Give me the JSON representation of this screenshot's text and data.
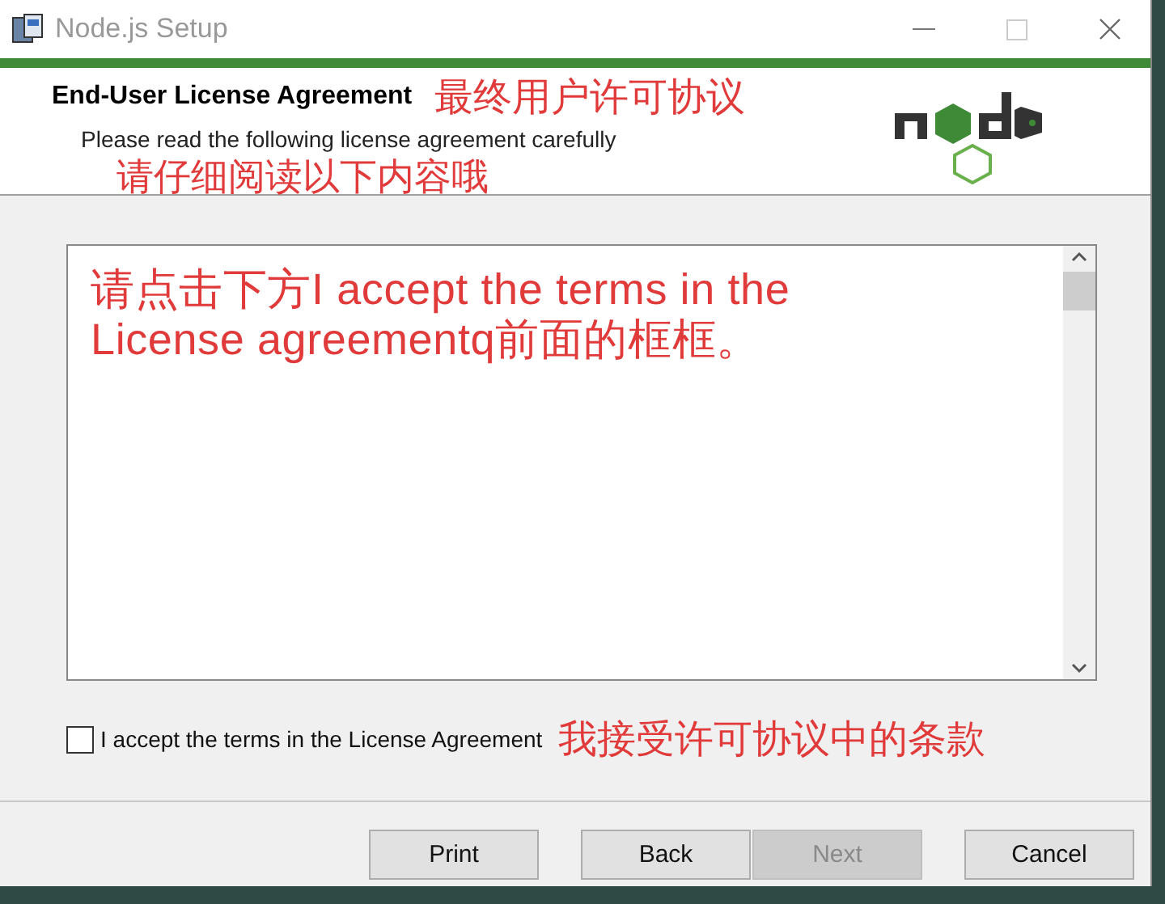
{
  "window": {
    "title": "Node.js Setup"
  },
  "header": {
    "title": "End-User License Agreement",
    "title_note": "最终用户许可协议",
    "subtitle": "Please read the following license agreement carefully",
    "subtitle_note": "请仔细阅读以下内容哦"
  },
  "license": {
    "text": "请点击下方I accept the terms in the License agreementq前面的框框。"
  },
  "accept": {
    "label": "I accept the terms in the License Agreement",
    "checked": false,
    "note": "我接受许可协议中的条款"
  },
  "buttons": [
    {
      "label": "Print",
      "disabled": false
    },
    {
      "label": "Back",
      "disabled": false
    },
    {
      "label": "Next",
      "disabled": true
    },
    {
      "label": "Cancel",
      "disabled": false
    }
  ]
}
